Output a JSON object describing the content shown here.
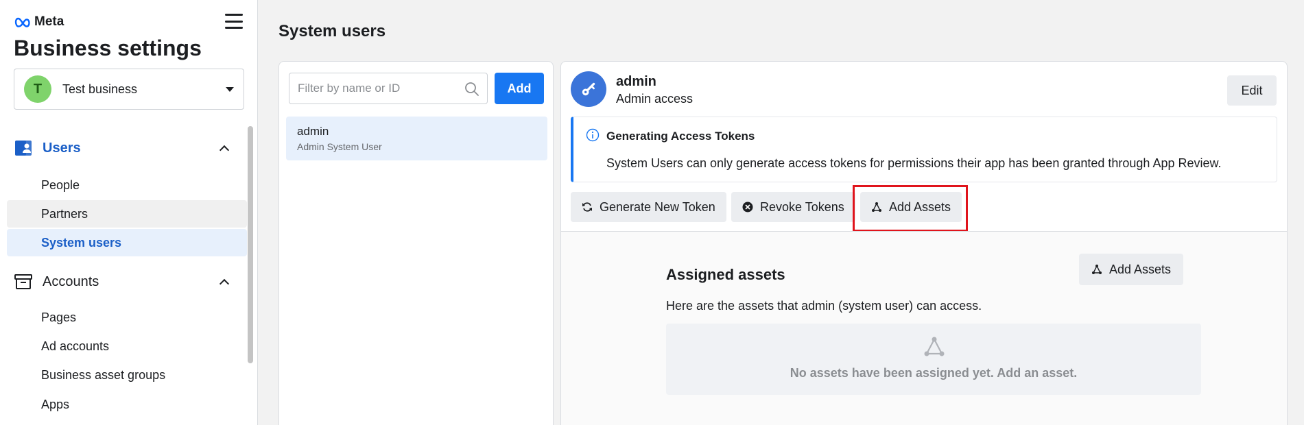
{
  "sidebar": {
    "brand": "Meta",
    "title": "Business settings",
    "business": {
      "initial": "T",
      "name": "Test business"
    },
    "sections": [
      {
        "label": "Users",
        "items": [
          "People",
          "Partners",
          "System users"
        ]
      },
      {
        "label": "Accounts",
        "items": [
          "Pages",
          "Ad accounts",
          "Business asset groups",
          "Apps"
        ]
      }
    ]
  },
  "main": {
    "title": "System users",
    "search": {
      "placeholder": "Filter by name or ID",
      "value": ""
    },
    "add_label": "Add",
    "list": [
      {
        "name": "admin",
        "subtitle": "Admin System User"
      }
    ]
  },
  "detail": {
    "name": "admin",
    "role": "Admin access",
    "edit_label": "Edit",
    "notice": {
      "title": "Generating Access Tokens",
      "body": "System Users can only generate access tokens for permissions their app has been granted through App Review."
    },
    "actions": {
      "generate": "Generate New Token",
      "revoke": "Revoke Tokens",
      "add_assets": "Add Assets"
    },
    "assets": {
      "title": "Assigned assets",
      "add_label": "Add Assets",
      "description": "Here are the assets that admin (system user) can access.",
      "empty": "No assets have been assigned yet. Add an asset."
    }
  },
  "colors": {
    "primary": "#1877f2",
    "active_nav_text": "#1b5fc7",
    "active_nav_bg": "#e7f0fc",
    "highlight": "#e0141c",
    "avatar_green": "#7fd36b"
  }
}
